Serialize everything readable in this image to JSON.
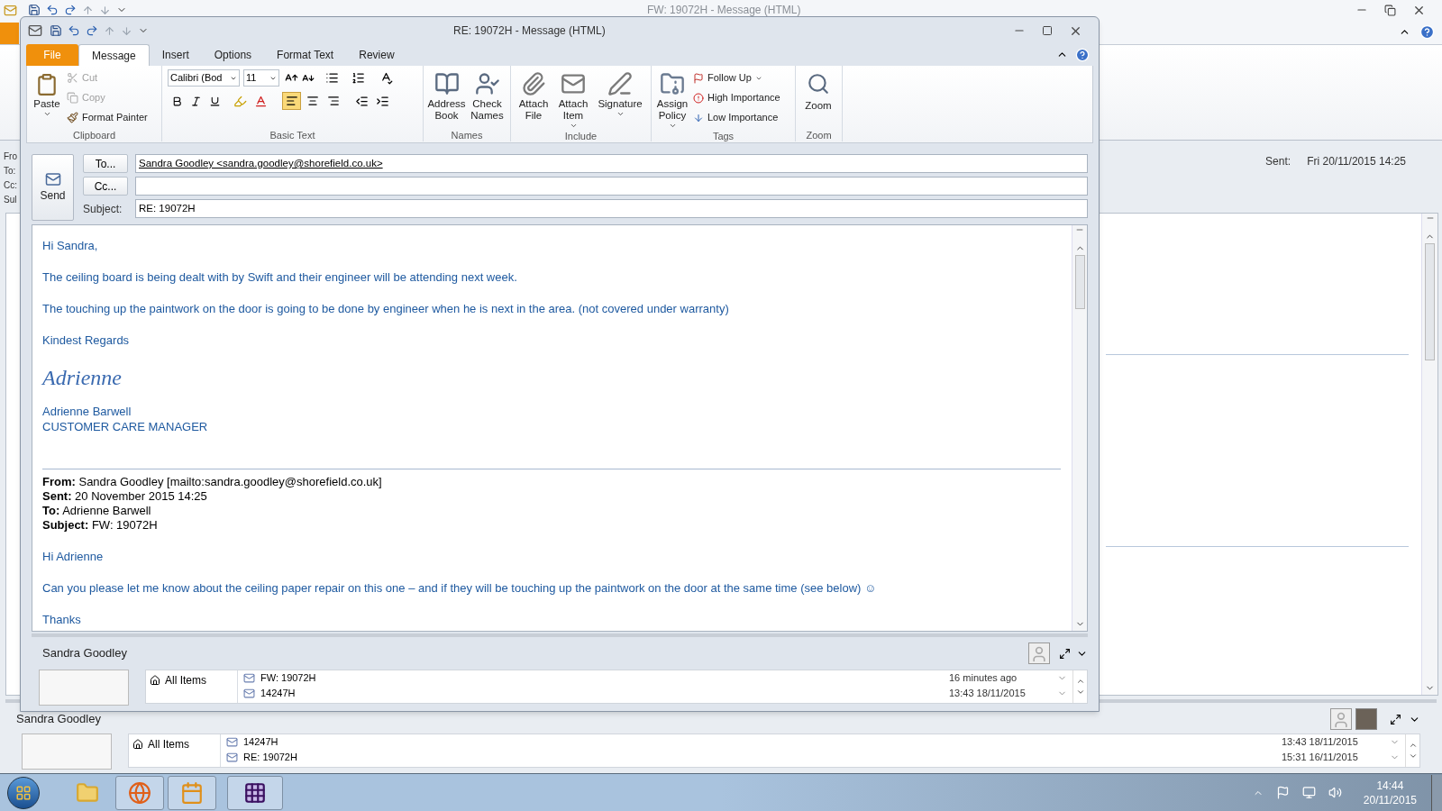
{
  "background_window": {
    "title": "FW: 19072H  -  Message (HTML)",
    "header_labels": [
      "Fro",
      "To:",
      "Cc:",
      "Sul"
    ],
    "sent_label": "Sent:",
    "sent_value": "Fri 20/11/2015 14:25",
    "people_pane": {
      "name": "Sandra Goodley",
      "filter": "All Items",
      "items": [
        {
          "subject": "14247H",
          "time": "13:43  18/11/2015"
        },
        {
          "subject": "RE: 19072H",
          "time": "15:31  16/11/2015"
        }
      ]
    }
  },
  "compose_window": {
    "title": "RE: 19072H  -  Message (HTML)",
    "tabs": [
      {
        "label": "File",
        "kind": "file",
        "selected": false
      },
      {
        "label": "Message",
        "kind": "tab",
        "selected": true
      },
      {
        "label": "Insert",
        "kind": "tab",
        "selected": false
      },
      {
        "label": "Options",
        "kind": "tab",
        "selected": false
      },
      {
        "label": "Format Text",
        "kind": "tab",
        "selected": false
      },
      {
        "label": "Review",
        "kind": "tab",
        "selected": false
      }
    ],
    "ribbon": {
      "clipboard": {
        "label": "Clipboard",
        "paste": "Paste",
        "items": [
          {
            "kind": "cut",
            "label": "Cut",
            "disabled": true
          },
          {
            "kind": "copy",
            "label": "Copy",
            "disabled": true
          },
          {
            "kind": "painter",
            "label": "Format Painter",
            "disabled": false
          }
        ]
      },
      "basic_text": {
        "label": "Basic Text",
        "font": "Calibri (Bod",
        "size": "11",
        "align": [
          {
            "kind": "left",
            "selected": true
          },
          {
            "kind": "center",
            "selected": false
          },
          {
            "kind": "right",
            "selected": false
          }
        ]
      },
      "names": {
        "label": "Names",
        "buttons": [
          {
            "kind": "address_book",
            "lines": [
              "Address",
              "Book"
            ]
          },
          {
            "kind": "check_names",
            "lines": [
              "Check",
              "Names"
            ]
          }
        ]
      },
      "include": {
        "label": "Include",
        "buttons": [
          {
            "kind": "attach_file",
            "lines": [
              "Attach",
              "File"
            ],
            "dropdown": false
          },
          {
            "kind": "attach_item",
            "lines": [
              "Attach",
              "Item"
            ],
            "dropdown": true
          },
          {
            "kind": "signature",
            "lines": [
              "Signature"
            ],
            "dropdown": true
          }
        ]
      },
      "tags": {
        "label": "Tags",
        "policy": [
          "Assign",
          "Policy"
        ],
        "items": [
          {
            "kind": "follow_up",
            "label": "Follow Up",
            "dropdown": true
          },
          {
            "kind": "high",
            "label": "High Importance",
            "dropdown": false
          },
          {
            "kind": "low",
            "label": "Low Importance",
            "dropdown": false
          }
        ]
      },
      "zoom": {
        "label": "Zoom",
        "button": "Zoom"
      }
    },
    "header": {
      "send": "Send",
      "to_button": "To...",
      "cc_button": "Cc...",
      "subject_label": "Subject:",
      "to": "Sandra Goodley <sandra.goodley@shorefield.co.uk>",
      "subject": "RE: 19072H"
    },
    "body": [
      {
        "kind": "para",
        "text": "Hi Sandra,"
      },
      {
        "kind": "para",
        "text": "The ceiling board is being dealt with by Swift and their engineer will be attending next week."
      },
      {
        "kind": "para",
        "text": "The touching up the paintwork on the door is going to be done by engineer when he is next in the area.  (not covered under warranty)"
      },
      {
        "kind": "para",
        "text": "Kindest Regards"
      },
      {
        "kind": "signature",
        "text": "Adrienne"
      },
      {
        "kind": "line",
        "text": "Adrienne Barwell"
      },
      {
        "kind": "line",
        "text": "CUSTOMER CARE MANAGER"
      },
      {
        "kind": "rule"
      },
      {
        "kind": "quote",
        "text": "**From:** Sandra Goodley [mailto:sandra.goodley@shorefield.co.uk]"
      },
      {
        "kind": "quote",
        "text": "**Sent:** 20 November 2015 14:25"
      },
      {
        "kind": "quote",
        "text": "**To:** Adrienne Barwell"
      },
      {
        "kind": "quote",
        "text": "**Subject:** FW: 19072H"
      },
      {
        "kind": "gap"
      },
      {
        "kind": "para",
        "text": "Hi Adrienne"
      },
      {
        "kind": "para",
        "text": "Can you please let me know about the ceiling paper repair on this one – and if they will be touching up the paintwork on the door at the same time (see below) ☺"
      },
      {
        "kind": "para",
        "text": "Thanks"
      }
    ],
    "people_pane": {
      "name": "Sandra Goodley",
      "filter": "All Items",
      "items": [
        {
          "subject": "FW: 19072H",
          "time": "16 minutes ago"
        },
        {
          "subject": "14247H",
          "time": "13:43  18/11/2015"
        }
      ]
    }
  },
  "taskbar": {
    "time": "14:44",
    "date": "20/11/2015"
  }
}
